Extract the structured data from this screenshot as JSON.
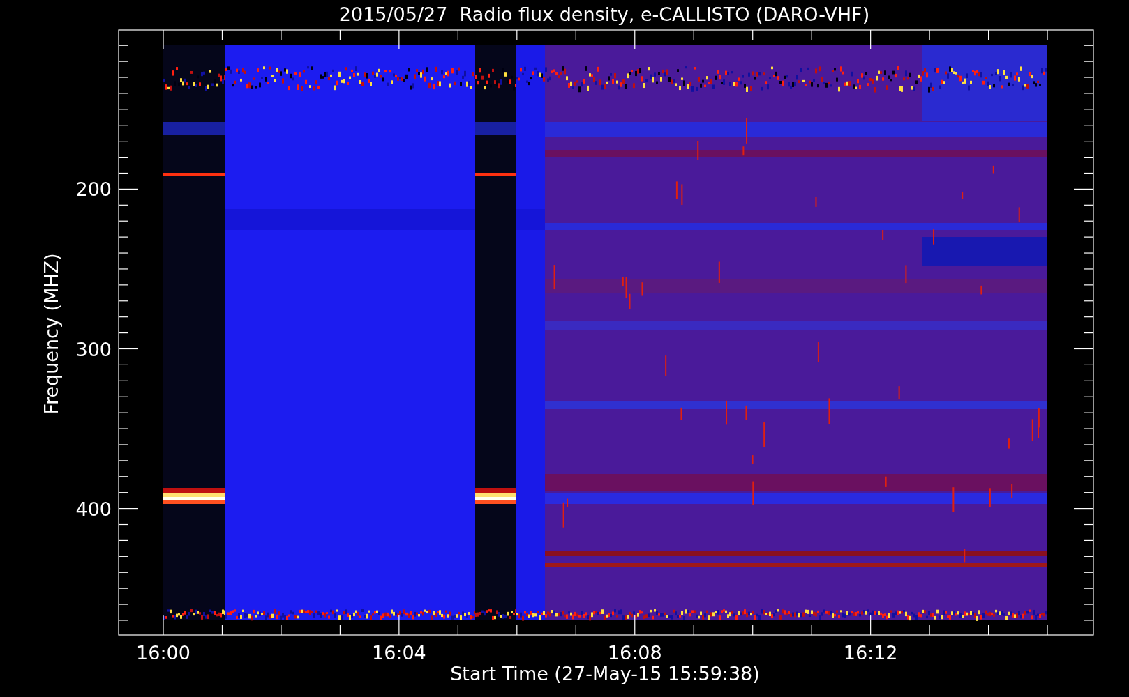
{
  "title": "2015/05/27  Radio flux density, e-CALLISTO (DARO-VHF)",
  "y_axis": {
    "label": "Frequency (MHZ)",
    "ticks": [
      "200",
      "300",
      "400"
    ]
  },
  "x_axis": {
    "label": "Start Time (27-May-15 15:59:38)",
    "ticks": [
      "16:00",
      "16:04",
      "16:08",
      "16:12"
    ]
  }
}
